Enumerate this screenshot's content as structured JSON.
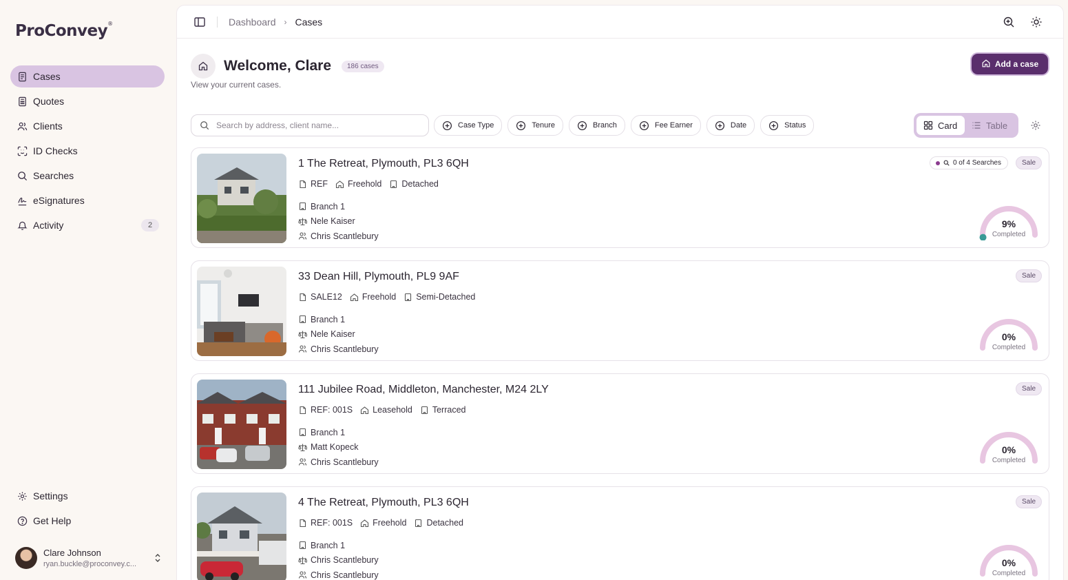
{
  "app": {
    "logo": "ProConvey",
    "logo_mark": "®"
  },
  "sidebar": {
    "items": [
      {
        "label": "Cases",
        "icon": "document-icon",
        "active": true
      },
      {
        "label": "Quotes",
        "icon": "calculator-icon"
      },
      {
        "label": "Clients",
        "icon": "users-icon"
      },
      {
        "label": "ID Checks",
        "icon": "scan-face-icon"
      },
      {
        "label": "Searches",
        "icon": "search-icon"
      },
      {
        "label": "eSignatures",
        "icon": "signature-icon"
      },
      {
        "label": "Activity",
        "icon": "bell-icon",
        "badge": "2"
      }
    ],
    "bottom": [
      {
        "label": "Settings",
        "icon": "gear-icon"
      },
      {
        "label": "Get Help",
        "icon": "help-circle-icon"
      }
    ],
    "user": {
      "name": "Clare Johnson",
      "email": "ryan.buckle@proconvey.c..."
    }
  },
  "topbar": {
    "breadcrumb": [
      "Dashboard",
      "Cases"
    ]
  },
  "header": {
    "title": "Welcome, Clare",
    "count": "186 cases",
    "subtitle": "View your current cases.",
    "add_button": "Add a case"
  },
  "filters": {
    "search_placeholder": "Search by address, client name...",
    "chips": [
      "Case Type",
      "Tenure",
      "Branch",
      "Fee Earner",
      "Date",
      "Status"
    ],
    "view_card": "Card",
    "view_table": "Table"
  },
  "colors": {
    "accent": "#5a2e6c",
    "accent_light": "#d9c4e2",
    "gauge_track": "#e8c6e1",
    "gauge_fill": "#3a9a96"
  },
  "cases": [
    {
      "address": "1 The Retreat, Plymouth, PL3 6QH",
      "ref": "REF",
      "tenure": "Freehold",
      "property_type": "Detached",
      "branch": "Branch 1",
      "fee_earner": "Nele Kaiser",
      "client": "Chris Scantlebury",
      "searches": "0 of 4 Searches",
      "type": "Sale",
      "progress_pct": "9%",
      "progress_value": 9,
      "progress_label": "Completed"
    },
    {
      "address": "33 Dean Hill, Plymouth, PL9 9AF",
      "ref": "SALE12",
      "tenure": "Freehold",
      "property_type": "Semi-Detached",
      "branch": "Branch 1",
      "fee_earner": "Nele Kaiser",
      "client": "Chris Scantlebury",
      "type": "Sale",
      "progress_pct": "0%",
      "progress_value": 0,
      "progress_label": "Completed"
    },
    {
      "address": "111 Jubilee Road, Middleton, Manchester, M24 2LY",
      "ref": "REF: 001S",
      "tenure": "Leasehold",
      "property_type": "Terraced",
      "branch": "Branch 1",
      "fee_earner": "Matt Kopeck",
      "client": "Chris Scantlebury",
      "type": "Sale",
      "progress_pct": "0%",
      "progress_value": 0,
      "progress_label": "Completed"
    },
    {
      "address": "4 The Retreat, Plymouth, PL3 6QH",
      "ref": "REF: 001S",
      "tenure": "Freehold",
      "property_type": "Detached",
      "branch": "Branch 1",
      "fee_earner": "Chris Scantlebury",
      "client": "Chris Scantlebury",
      "type": "Sale",
      "progress_pct": "0%",
      "progress_value": 0,
      "progress_label": "Completed"
    }
  ]
}
